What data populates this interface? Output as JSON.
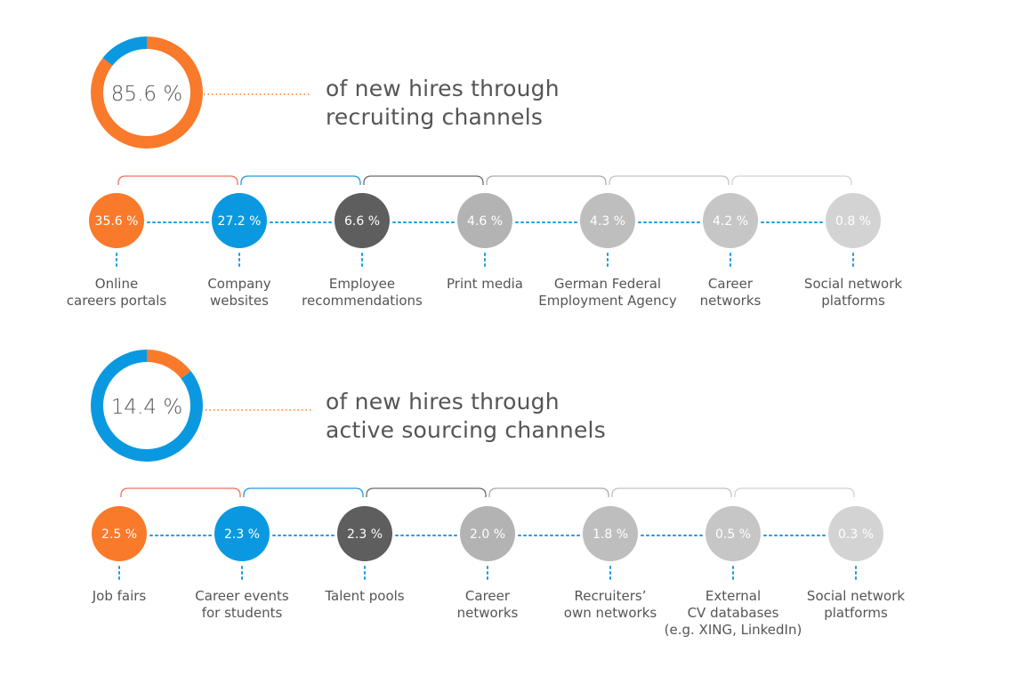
{
  "colors": {
    "orange": "#F97A2B",
    "blue": "#0A99E0",
    "dark": "#5E5E5E",
    "gray1": "#B3B3B3",
    "gray2": "#BEBEBE",
    "gray3": "#C6C6C6",
    "gray4": "#D3D3D3",
    "connector": "#1E9BE0",
    "bracket": [
      "#F2705A",
      "#1E9BE0",
      "#6A6A6A",
      "#ABABAB",
      "#C2C2C2",
      "#D2D2D2"
    ]
  },
  "chart_data": [
    {
      "type": "pie",
      "title": "of new hires through recruiting channels",
      "center_label": "85.6 %",
      "slices": [
        {
          "name": "recruiting channels",
          "value": 85.6,
          "color": "#F97A2B"
        },
        {
          "name": "active sourcing channels",
          "value": 14.4,
          "color": "#0A99E0"
        }
      ],
      "headline": [
        "of new hires through",
        "recruiting channels"
      ],
      "nodes": [
        {
          "value_label": "35.6 %",
          "value": 35.6,
          "label": [
            "Online",
            "careers portals"
          ],
          "color": "orange"
        },
        {
          "value_label": "27.2 %",
          "value": 27.2,
          "label": [
            "Company",
            "websites"
          ],
          "color": "blue"
        },
        {
          "value_label": "6.6 %",
          "value": 6.6,
          "label": [
            "Employee",
            "recommendations"
          ],
          "color": "dark"
        },
        {
          "value_label": "4.6 %",
          "value": 4.6,
          "label": [
            "Print media"
          ],
          "color": "gray1"
        },
        {
          "value_label": "4.3 %",
          "value": 4.3,
          "label": [
            "German Federal",
            "Employment Agency"
          ],
          "color": "gray2"
        },
        {
          "value_label": "4.2 %",
          "value": 4.2,
          "label": [
            "Career",
            "networks"
          ],
          "color": "gray3"
        },
        {
          "value_label": "0.8 %",
          "value": 0.8,
          "label": [
            "Social network",
            "platforms"
          ],
          "color": "gray4"
        }
      ]
    },
    {
      "type": "pie",
      "title": "of new hires through active sourcing channels",
      "center_label": "14.4 %",
      "slices": [
        {
          "name": "active sourcing channels",
          "value": 14.4,
          "color": "#F97A2B"
        },
        {
          "name": "recruiting channels",
          "value": 85.6,
          "color": "#0A99E0"
        }
      ],
      "headline": [
        "of new hires through",
        "active sourcing channels"
      ],
      "nodes": [
        {
          "value_label": "2.5 %",
          "value": 2.5,
          "label": [
            "Job fairs"
          ],
          "color": "orange"
        },
        {
          "value_label": "2.3 %",
          "value": 2.3,
          "label": [
            "Career events",
            "for students"
          ],
          "color": "blue"
        },
        {
          "value_label": "2.3 %",
          "value": 2.3,
          "label": [
            "Talent pools"
          ],
          "color": "dark"
        },
        {
          "value_label": "2.0 %",
          "value": 2.0,
          "label": [
            "Career",
            "networks"
          ],
          "color": "gray1"
        },
        {
          "value_label": "1.8 %",
          "value": 1.8,
          "label": [
            "Recruiters’",
            "own networks"
          ],
          "color": "gray2"
        },
        {
          "value_label": "0.5 %",
          "value": 0.5,
          "label": [
            "External",
            "CV databases",
            "(e.g. XING, LinkedIn)"
          ],
          "color": "gray3"
        },
        {
          "value_label": "0.3 %",
          "value": 0.3,
          "label": [
            "Social network",
            "platforms"
          ],
          "color": "gray4"
        }
      ]
    }
  ]
}
